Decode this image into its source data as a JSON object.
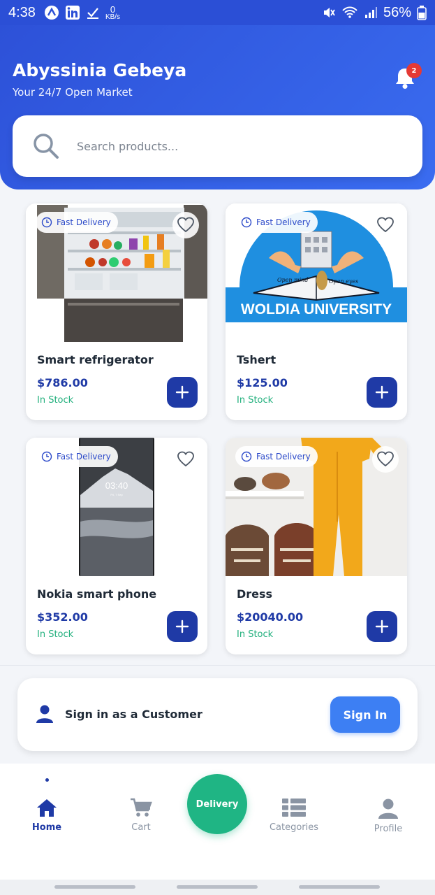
{
  "status_bar": {
    "time": "4:38",
    "data_rate_value": "0",
    "data_rate_unit": "KB/s",
    "battery": "56%",
    "icons": [
      "app-a-icon",
      "linkedin-icon",
      "download-check-icon",
      "mute-icon",
      "wifi-icon",
      "signal-icon",
      "battery-icon"
    ]
  },
  "header": {
    "title": "Abyssinia Gebeya",
    "subtitle": "Your 24/7 Open Market",
    "notification_count": "2"
  },
  "search": {
    "placeholder": "Search products..."
  },
  "products": [
    {
      "name": "Smart refrigerator",
      "price": "$786.00",
      "stock": "In Stock",
      "badge": "Fast Delivery",
      "image": "refrigerator-photo"
    },
    {
      "name": "Tshert",
      "price": "$125.00",
      "stock": "In Stock",
      "badge": "Fast Delivery",
      "image": "woldia-university-logo"
    },
    {
      "name": "Nokia smart phone",
      "price": "$352.00",
      "stock": "In Stock",
      "badge": "Fast Delivery",
      "image": "phone-photo"
    },
    {
      "name": "Dress",
      "price": "$20040.00",
      "stock": "In Stock",
      "badge": "Fast Delivery",
      "image": "dress-photo"
    }
  ],
  "logo_text": {
    "banner": "WOLDIA UNIVERSITY",
    "book_left": "Open mind",
    "book_right": "Open eyes"
  },
  "phone_screen": {
    "time": "03:40",
    "date": "Fri, 7 Sep"
  },
  "signin": {
    "label": "Sign in as a Customer",
    "button": "Sign In"
  },
  "nav": {
    "home": "Home",
    "cart": "Cart",
    "delivery": "Delivery",
    "categories": "Categories",
    "profile": "Profile"
  },
  "colors": {
    "header_blue": "#2d51d8",
    "price_blue": "#1f3aa6",
    "stock_green": "#22b07d",
    "delivery_green": "#1fb584",
    "signin_blue": "#3d7ff3"
  }
}
